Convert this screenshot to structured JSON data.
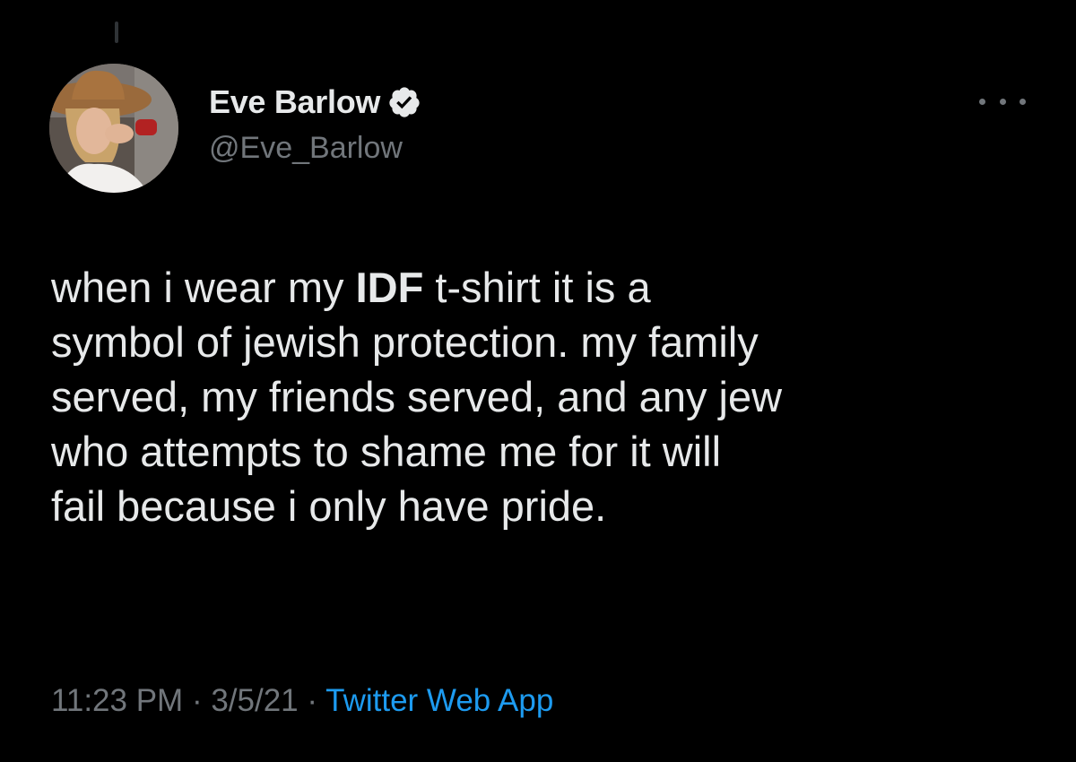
{
  "author": {
    "display_name": "Eve Barlow",
    "handle": "@Eve_Barlow",
    "verified_icon": "verified-badge-icon",
    "avatar_alt": "profile-photo"
  },
  "more_icon": "more-horizontal-icon",
  "tweet": {
    "text_part1": "when i wear my ",
    "text_bold": "IDF",
    "text_part2": " t-shirt it is a\nsymbol of jewish protection. my family\nserved, my friends served, and any jew\nwho attempts to shame me for it will\nfail because i only have pride."
  },
  "meta": {
    "time": "11:23 PM",
    "separator": " · ",
    "date": "3/5/21",
    "source": "Twitter Web App"
  },
  "colors": {
    "background": "#000000",
    "text_primary": "#e7e9ea",
    "text_secondary": "#71767b",
    "link": "#1d9bf0"
  }
}
